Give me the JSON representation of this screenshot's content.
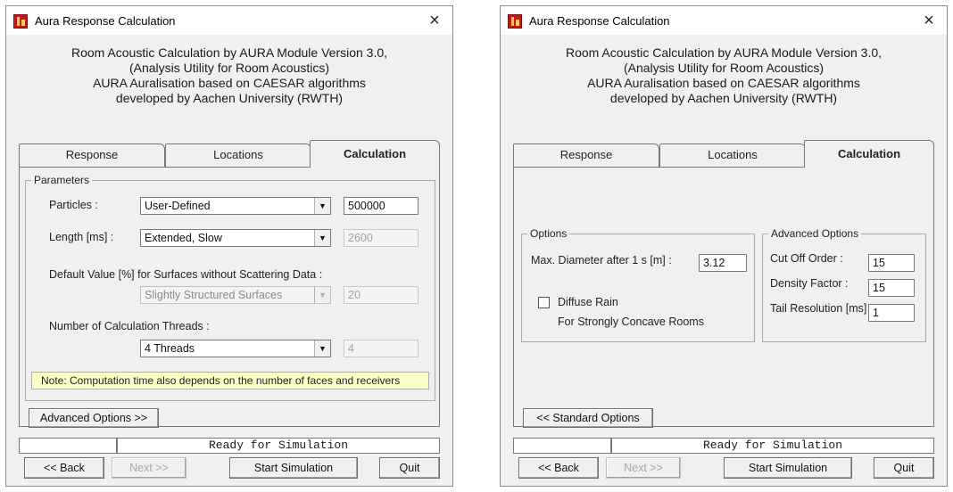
{
  "dialogs": [
    {
      "title": "Aura Response Calculation",
      "close_label": "×",
      "header_lines": [
        "Room Acoustic Calculation by AURA Module Version 3.0,",
        "(Analysis Utility for Room Acoustics)",
        "AURA Auralisation based on CAESAR algorithms",
        "developed by Aachen University (RWTH)"
      ],
      "tabs": [
        "Response",
        "Locations",
        "Calculation"
      ],
      "active_tab": "Calculation",
      "parameters": {
        "group_label": "Parameters",
        "particles_label": "Particles :",
        "particles_select": "User-Defined",
        "particles_value": "500000",
        "length_label": "Length [ms] :",
        "length_select": "Extended, Slow",
        "length_value": "2600",
        "default_value_label": "Default Value [%] for Surfaces without Scattering Data :",
        "scattering_select": "Slightly Structured Surfaces",
        "scattering_value": "20",
        "threads_label": "Number of Calculation Threads :",
        "threads_select": "4 Threads",
        "threads_value": "4",
        "note": "Note: Computation time also depends on the number of faces and receivers"
      },
      "toggle_options_button": "Advanced Options >>",
      "status": "Ready for Simulation",
      "buttons": {
        "back": "<< Back",
        "next": "Next >>",
        "start": "Start Simulation",
        "quit": "Quit"
      }
    },
    {
      "title": "Aura Response Calculation",
      "close_label": "×",
      "header_lines": [
        "Room Acoustic Calculation by AURA Module Version 3.0,",
        "(Analysis Utility for Room Acoustics)",
        "AURA Auralisation based on CAESAR algorithms",
        "developed by Aachen University (RWTH)"
      ],
      "tabs": [
        "Response",
        "Locations",
        "Calculation"
      ],
      "active_tab": "Calculation",
      "options": {
        "group_label": "Options",
        "max_diameter_label": "Max. Diameter after 1 s [m] :",
        "max_diameter_value": "3.12",
        "diffuse_rain_label": "Diffuse Rain",
        "diffuse_rain_checked": false,
        "diffuse_rain_hint": "For Strongly Concave Rooms"
      },
      "advanced_options": {
        "group_label": "Advanced Options",
        "cut_off_label": "Cut Off Order :",
        "cut_off_value": "15",
        "density_label": "Density Factor :",
        "density_value": "15",
        "tail_label": "Tail Resolution [ms] :",
        "tail_value": "1"
      },
      "toggle_options_button": "<< Standard Options",
      "status": "Ready for Simulation",
      "buttons": {
        "back": "<< Back",
        "next": "Next >>",
        "start": "Start Simulation",
        "quit": "Quit"
      }
    }
  ]
}
